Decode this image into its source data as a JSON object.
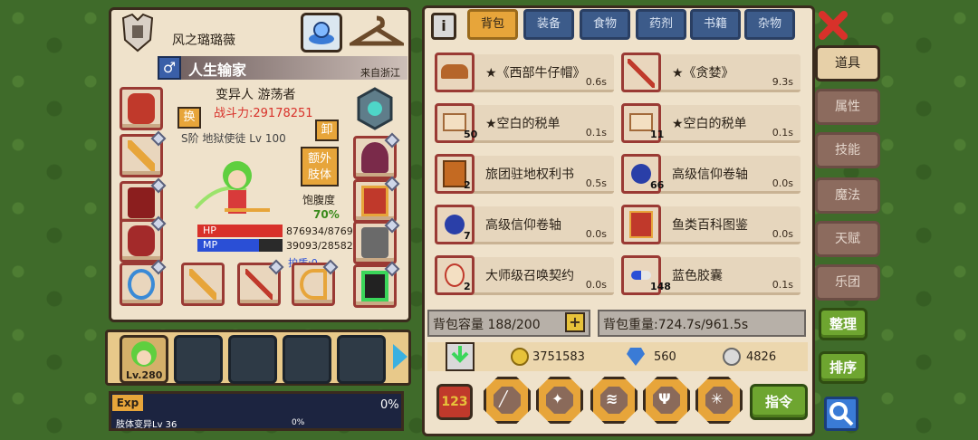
{
  "character": {
    "name": "风之璐璐薇",
    "title": "人生输家",
    "origin": "来自浙江",
    "class": "变异人 游荡者",
    "power": "战斗力:29178251",
    "swap_label": "换",
    "unequip_label": "卸",
    "rank_text": "S阶 地狱使徒 Lv 100",
    "extra_limb_label": "额外肢体",
    "satiety_label": "饱腹度",
    "satiety_value": "70%",
    "hp_label": "HP",
    "hp_value": "876934/8769",
    "mp_label": "MP",
    "mp_value": "39093/28582",
    "shield": "护盾:0",
    "hp_fraction": 1.0,
    "mp_fraction": 0.72
  },
  "party": {
    "leader_level": "Lv.280"
  },
  "exp": {
    "label": "Exp",
    "percent": "0%",
    "fraction": 0,
    "sub_label": "肢体变异Lv 36",
    "sub_percent": "0%"
  },
  "tabs": [
    "背包",
    "装备",
    "食物",
    "药剂",
    "书籍",
    "杂物"
  ],
  "active_tab": "背包",
  "items": [
    {
      "name": "★《西部牛仔帽》",
      "weight": "0.6s",
      "count": "",
      "icon": "cowboy-hat-icon"
    },
    {
      "name": "★《贪婪》",
      "weight": "9.3s",
      "count": "",
      "icon": "red-spear-icon"
    },
    {
      "name": "★空白的税单",
      "weight": "0.1s",
      "count": "50",
      "icon": "tax-form-icon"
    },
    {
      "name": "★空白的税单",
      "weight": "0.1s",
      "count": "11",
      "icon": "tax-form-icon"
    },
    {
      "name": "旅团驻地权利书",
      "weight": "0.5s",
      "count": "2",
      "icon": "deed-book-icon"
    },
    {
      "name": "高级信仰卷轴",
      "weight": "0.0s",
      "count": "66",
      "icon": "faith-scroll-icon"
    },
    {
      "name": "高级信仰卷轴",
      "weight": "0.0s",
      "count": "7",
      "icon": "faith-scroll-icon"
    },
    {
      "name": "鱼类百科图鉴",
      "weight": "0.0s",
      "count": "",
      "icon": "fish-encyclopedia-icon"
    },
    {
      "name": "大师级召唤契约",
      "weight": "0.0s",
      "count": "2",
      "icon": "summon-contract-icon"
    },
    {
      "name": "蓝色胶囊",
      "weight": "0.1s",
      "count": "148",
      "icon": "blue-capsule-icon"
    }
  ],
  "bag": {
    "capacity_label": "背包容量 188/200",
    "weight_label": "背包重量:724.7s/961.5s"
  },
  "currency": {
    "gold": "3751583",
    "diamond": "560",
    "silver": "4826"
  },
  "side_menu": [
    "道具",
    "属性",
    "技能",
    "魔法",
    "天赋",
    "乐团"
  ],
  "side_active": "道具",
  "buttons": {
    "organize": "整理",
    "sort": "排序",
    "command": "指令"
  },
  "colors": {
    "hp": "#d8312a",
    "mp": "#2a4fd6",
    "power": "#d8312a",
    "accent": "#e7a53a"
  }
}
